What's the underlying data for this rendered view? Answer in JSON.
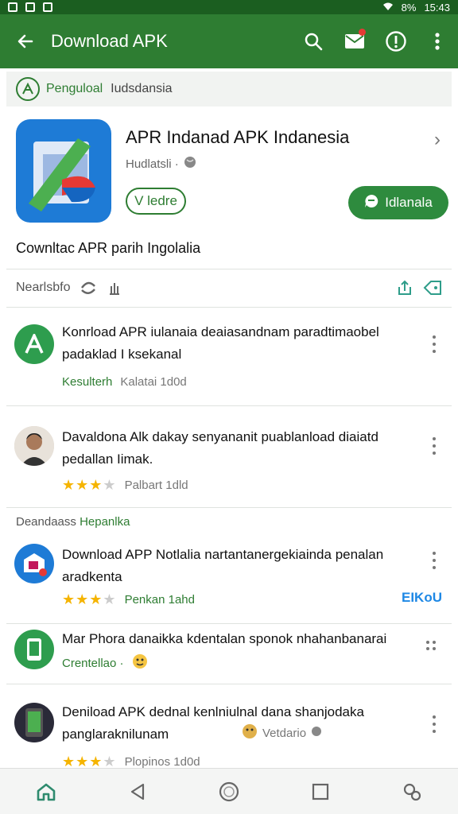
{
  "status_bar": {
    "time": "15:43",
    "battery": "8%"
  },
  "app_bar": {
    "title": "Download APK"
  },
  "breadcrumb": {
    "label": "Penguloal",
    "sub": "Iudsdansia"
  },
  "hero": {
    "title": "APR Indanad APK Indanesia",
    "subtitle": "Hudlatsli ·",
    "pill_outline": "V ledre",
    "pill_button": "Idlanala",
    "description": "Cownltac APR parih Ingolalia"
  },
  "meta_row": {
    "label": "Nearlsbfo"
  },
  "items": [
    {
      "text": "Konrload APR iulanaia deaiasandnam paradtimaobel padaklad I ksekanal",
      "meta1": "Kesulterh",
      "meta2": "Kalatai 1d0d"
    },
    {
      "text": "Davaldona Alk dakay senyananit puablanload diaiatd pedallan Iimak.",
      "rating": 3,
      "meta2": "Palbart 1dld"
    },
    {
      "text": "Download APP Notlalia nartantanergekiainda penalan aradkenta",
      "rating": 3,
      "meta2": "Penkan 1ahd",
      "tag": "EIKoU"
    },
    {
      "text": "Mar Phora danaikka kdentalan sponok nhahanbanarai",
      "meta1": "Crentellao ·"
    },
    {
      "text": "Deniload APK dednal kenlniulnal dana shanjodaka panglaraknilunam",
      "meta1": "Vetdario",
      "rating": 3,
      "meta2": "Plopinos 1d0d"
    }
  ],
  "section_header": {
    "part1": "Deandaass",
    "part2": "Hepanlka"
  },
  "colors": {
    "primary": "#2e7d32",
    "status": "#1b5e20",
    "accent_blue": "#1e7bd6",
    "star": "#f5b400"
  },
  "icons": [
    "back-arrow-icon",
    "search-icon",
    "mail-icon",
    "info-icon",
    "more-vert-icon",
    "home-icon",
    "back-icon",
    "circle-home-icon",
    "recents-icon",
    "settings-icon"
  ]
}
